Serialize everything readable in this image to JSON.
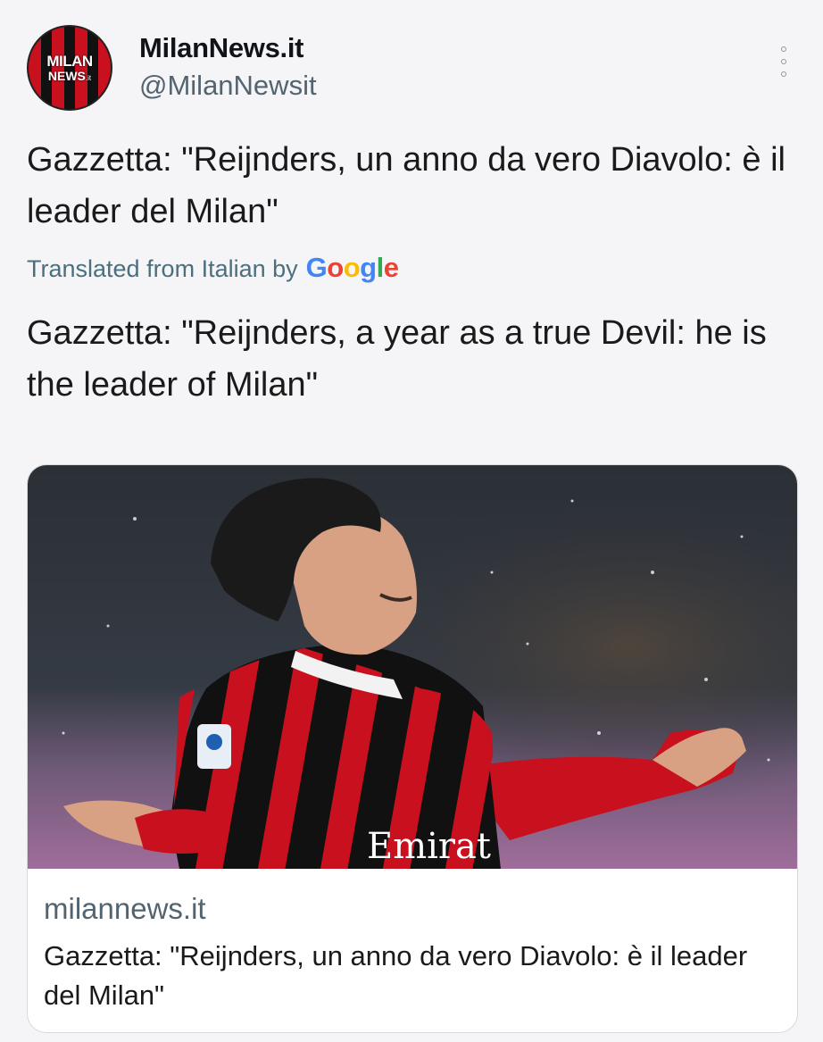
{
  "account": {
    "avatar_line1": "MILAN",
    "avatar_line2": "NEWS",
    "avatar_suffix": ".it",
    "name": "MilanNews.it",
    "handle": "@MilanNewsit"
  },
  "tweet": {
    "text": "Gazzetta: \"Reijnders, un anno da vero Diavolo: è il leader del Milan\"",
    "translated_label": "Translated from Italian by",
    "translator_brand": "Google",
    "translation": "Gazzetta: \"Reijnders, a year as a true Devil: he is the leader of Milan\""
  },
  "link_card": {
    "image_sponsor_text": "Emirat",
    "domain": "milannews.it",
    "title": "Gazzetta: \"Reijnders, un anno da vero Diavolo: è il leader del Milan\""
  },
  "icons": {
    "more": "more-vertical-icon"
  },
  "colors": {
    "milan_red": "#c8101e",
    "milan_black": "#111111",
    "secondary_text": "#536471",
    "google_blue": "#4285f4",
    "google_red": "#ea4335",
    "google_yellow": "#fbbc05",
    "google_green": "#34a853"
  }
}
